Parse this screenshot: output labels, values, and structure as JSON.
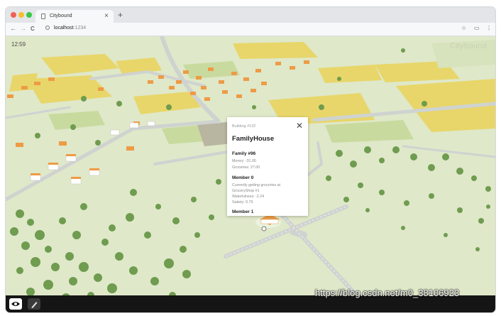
{
  "browser": {
    "tab_title": "Citybound",
    "tab_close": "×",
    "new_tab": "+",
    "url_host": "localhost",
    "url_port": ":1234",
    "nav_back": "←",
    "nav_forward": "→",
    "nav_reload": "C"
  },
  "hud": {
    "clock": "12:59",
    "brand": "Citybound"
  },
  "inspector": {
    "building_label": "Building #132",
    "close_label": "✕",
    "title": "FamilyHouse",
    "family_heading": "Family #96",
    "family_money": "Money: -31.00",
    "family_groceries": "Groceries: 27.00",
    "member_heading": "Member 0",
    "member_activity": "Currently getting groceries at",
    "member_location": "GroceryShop #1",
    "member_wakefulness": "Wakefulness: -2.24",
    "member_satiety": "Satiety: 0.79",
    "member_next": "Member 1"
  },
  "toolbar": {
    "view_tool": "eye-icon",
    "edit_tool": "pencil-icon"
  },
  "watermark": "https://blog.csdn.net/m0_38106923",
  "colors": {
    "grass": "#dfe8c9",
    "field": "#e8d66a",
    "road": "#cfd3d0",
    "tree": "#6f9c4f",
    "roof": "#ee9b45"
  }
}
